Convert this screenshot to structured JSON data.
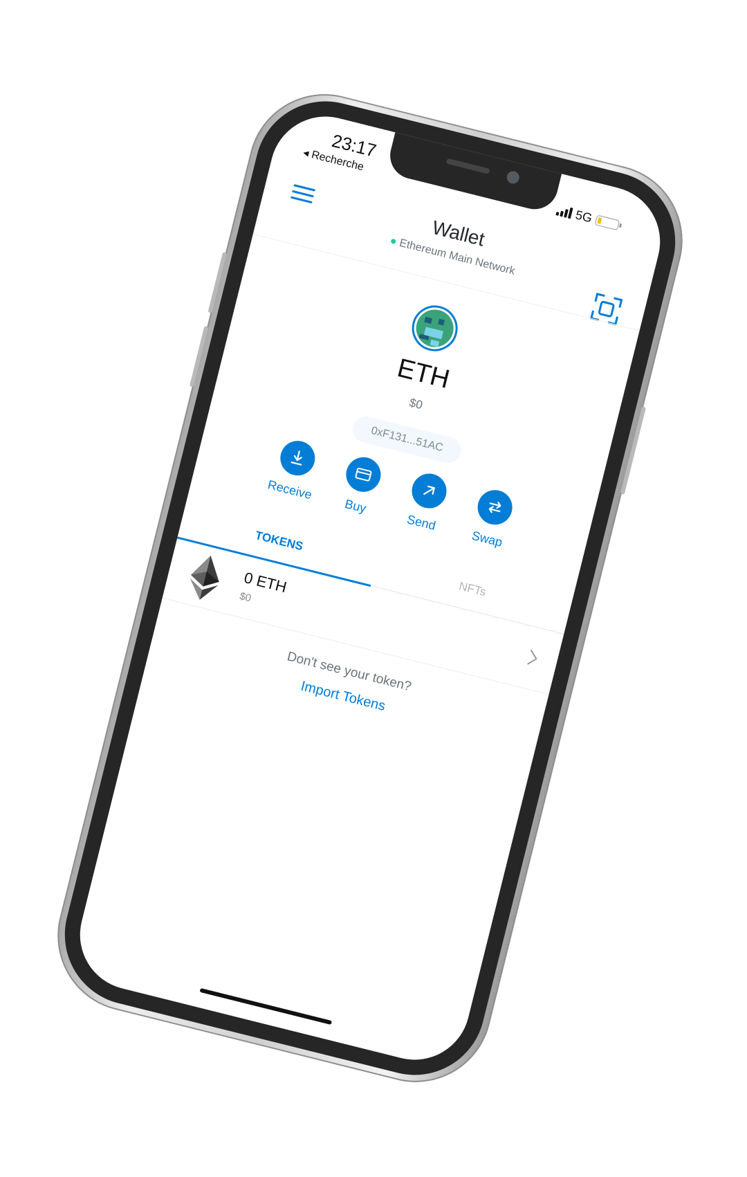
{
  "status_bar": {
    "time": "23:17",
    "back_label": "◂ Recherche",
    "network_type": "5G"
  },
  "header": {
    "title": "Wallet",
    "network": "Ethereum Main Network"
  },
  "account": {
    "balance_symbol": "ETH",
    "balance_fiat": "$0",
    "address": "0xF131...51AC"
  },
  "actions": [
    {
      "label": "Receive",
      "icon": "download-icon"
    },
    {
      "label": "Buy",
      "icon": "card-icon"
    },
    {
      "label": "Send",
      "icon": "arrow-up-right-icon"
    },
    {
      "label": "Swap",
      "icon": "swap-icon"
    }
  ],
  "tabs": {
    "tokens": "TOKENS",
    "nfts": "NFTs",
    "active": "tokens"
  },
  "tokens": [
    {
      "amount": "0 ETH",
      "fiat": "$0",
      "icon": "ethereum-icon"
    }
  ],
  "import": {
    "question": "Don't see your token?",
    "link": "Import Tokens"
  },
  "colors": {
    "accent": "#037dd6",
    "network_dot": "#28c99b",
    "battery": "#f2c200"
  }
}
